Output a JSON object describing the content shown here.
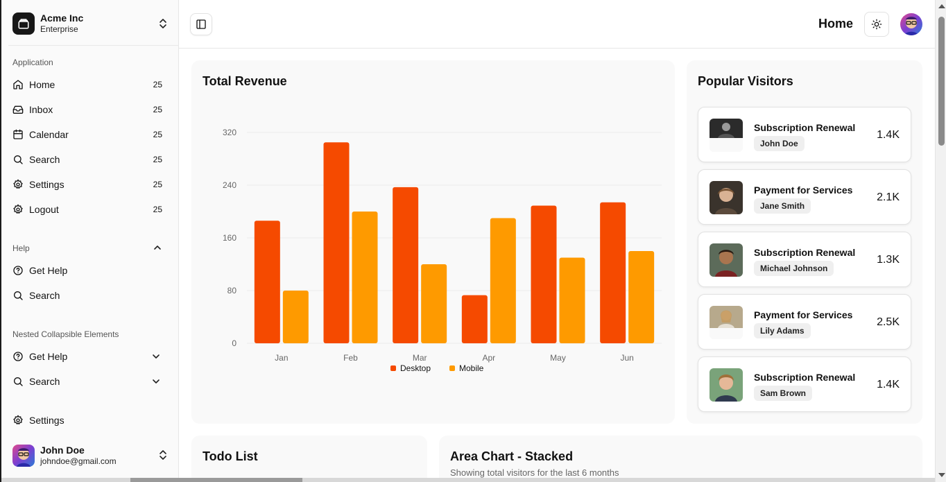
{
  "team": {
    "name": "Acme Inc",
    "plan": "Enterprise"
  },
  "sidebar": {
    "application_label": "Application",
    "items": [
      {
        "label": "Home",
        "count": "25",
        "icon": "home-icon"
      },
      {
        "label": "Inbox",
        "count": "25",
        "icon": "inbox-icon"
      },
      {
        "label": "Calendar",
        "count": "25",
        "icon": "calendar-icon"
      },
      {
        "label": "Search",
        "count": "25",
        "icon": "search-icon"
      },
      {
        "label": "Settings",
        "count": "25",
        "icon": "gear-icon"
      },
      {
        "label": "Logout",
        "count": "25",
        "icon": "logout-icon"
      }
    ],
    "help_label": "Help",
    "help_items": [
      {
        "label": "Get Help",
        "icon": "help-circle-icon"
      },
      {
        "label": "Search",
        "icon": "search-icon"
      }
    ],
    "nested_label": "Nested Collapsible Elements",
    "nested_items": [
      {
        "label": "Get Help",
        "icon": "help-circle-icon"
      },
      {
        "label": "Search",
        "icon": "search-icon"
      }
    ],
    "settings_label": "Settings"
  },
  "user": {
    "name": "John Doe",
    "email": "johndoe@gmail.com"
  },
  "header": {
    "title": "Home"
  },
  "revenue": {
    "title": "Total Revenue"
  },
  "chart_data": {
    "type": "bar",
    "title": "Total Revenue",
    "categories": [
      "Jan",
      "Feb",
      "Mar",
      "Apr",
      "May",
      "Jun"
    ],
    "series": [
      {
        "name": "Desktop",
        "color": "#f54a00",
        "values": [
          186,
          305,
          237,
          73,
          209,
          214
        ]
      },
      {
        "name": "Mobile",
        "color": "#fe9a00",
        "values": [
          80,
          200,
          120,
          190,
          130,
          140
        ]
      }
    ],
    "yticks": [
      0,
      80,
      160,
      240,
      320
    ],
    "ylim": [
      0,
      320
    ],
    "grid": true,
    "legend": "bottom-center"
  },
  "visitors": {
    "title": "Popular Visitors",
    "items": [
      {
        "title": "Subscription Renewal",
        "name": "John Doe",
        "value": "1.4K"
      },
      {
        "title": "Payment for Services",
        "name": "Jane Smith",
        "value": "2.1K"
      },
      {
        "title": "Subscription Renewal",
        "name": "Michael Johnson",
        "value": "1.3K"
      },
      {
        "title": "Payment for Services",
        "name": "Lily Adams",
        "value": "2.5K"
      },
      {
        "title": "Subscription Renewal",
        "name": "Sam Brown",
        "value": "1.4K"
      }
    ]
  },
  "todo": {
    "title": "Todo List"
  },
  "area": {
    "title": "Area Chart - Stacked",
    "subtitle": "Showing total visitors for the last 6 months"
  }
}
